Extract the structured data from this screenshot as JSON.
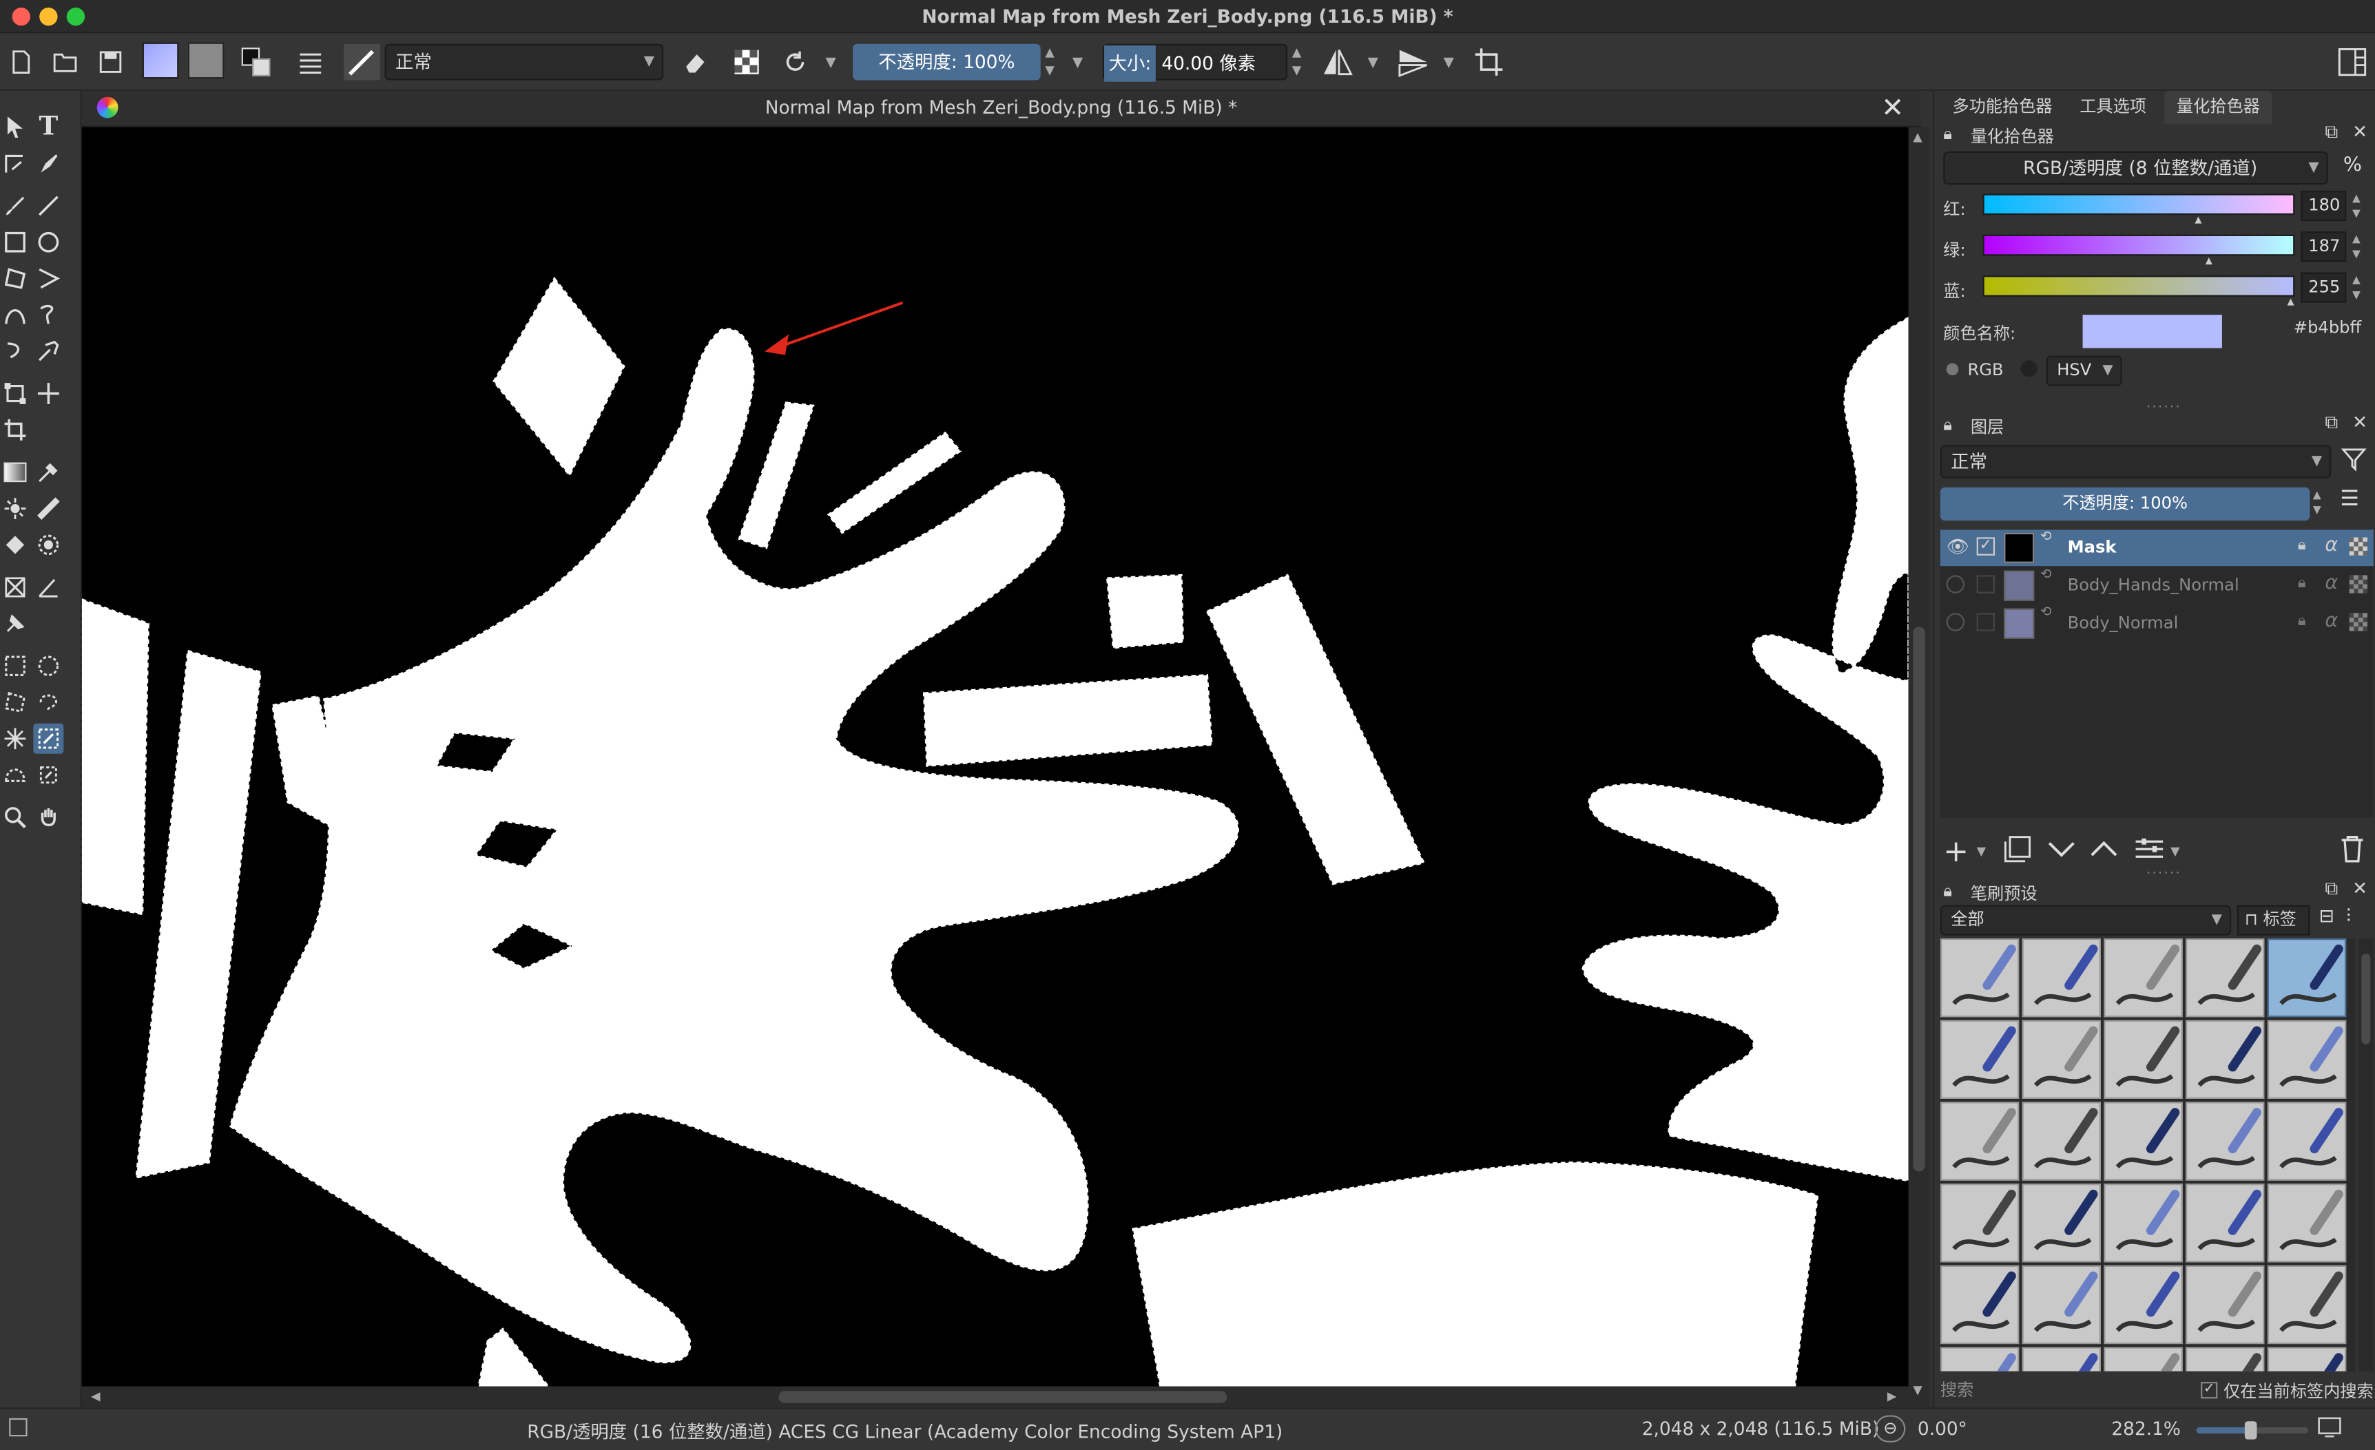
{
  "window": {
    "title": "Normal Map from Mesh Zeri_Body.png (116.5 MiB) *"
  },
  "toolbar": {
    "blend_mode": "正常",
    "opacity_label": "不透明度:",
    "opacity_value": "100%",
    "size_label": "大小:",
    "size_value": "40.00 像素"
  },
  "canvas": {
    "tab_title": "Normal Map from Mesh Zeri_Body.png (116.5 MiB) *"
  },
  "dock": {
    "tabs": [
      "多功能拾色器",
      "工具选项",
      "量化拾色器"
    ],
    "color_panel": {
      "title": "量化拾色器",
      "model": "RGB/透明度 (8 位整数/通道)",
      "percent": "%",
      "channels": [
        {
          "label": "红:",
          "value": "180"
        },
        {
          "label": "绿:",
          "value": "187"
        },
        {
          "label": "蓝:",
          "value": "255"
        }
      ],
      "name_label": "颜色名称:",
      "hex": "#b4bbff",
      "swatch_color": "#b4bbff",
      "rgb_label": "RGB",
      "hsv_label": "HSV"
    },
    "layers_panel": {
      "title": "图层",
      "blend_mode": "正常",
      "opacity": "不透明度: 100%",
      "layers": [
        {
          "name": "Mask",
          "visible": true,
          "selected": true
        },
        {
          "name": "Body_Hands_Normal",
          "visible": false,
          "selected": false
        },
        {
          "name": "Body_Normal",
          "visible": false,
          "selected": false
        }
      ]
    },
    "brush_panel": {
      "title": "笔刷预设",
      "filter": "全部",
      "tag_label": "标签",
      "search_placeholder": "搜索",
      "current_tag_only": "仅在当前标签内搜索"
    }
  },
  "status": {
    "colorspace": "RGB/透明度 (16 位整数/通道)  ACES CG Linear (Academy Color Encoding System AP1)",
    "dimensions": "2,048 x 2,048 (116.5 MiB)",
    "rotation": "0.00°",
    "zoom": "282.1%"
  },
  "colors": {
    "accent": "#4a6d93",
    "selection": "#4a6d93",
    "arrow": "#e0291b"
  }
}
